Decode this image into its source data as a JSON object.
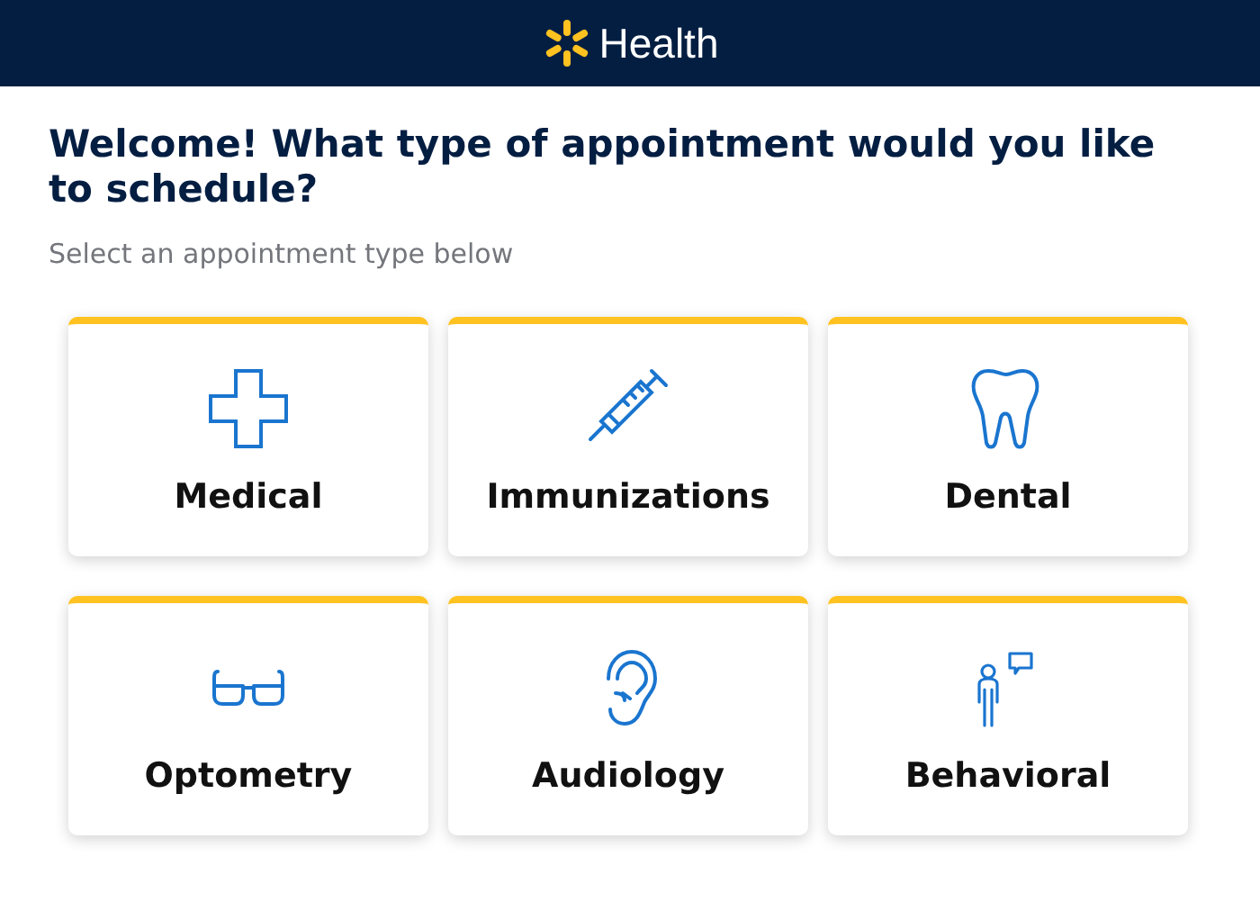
{
  "header": {
    "brand": "Health"
  },
  "title": "Welcome! What type of appointment would you like to schedule?",
  "subtitle": "Select an appointment type below",
  "cards": [
    {
      "kind": "medical",
      "label": "Medical"
    },
    {
      "kind": "immunizations",
      "label": "Immunizations"
    },
    {
      "kind": "dental",
      "label": "Dental"
    },
    {
      "kind": "optometry",
      "label": "Optometry"
    },
    {
      "kind": "audiology",
      "label": "Audiology"
    },
    {
      "kind": "behavioral",
      "label": "Behavioral"
    }
  ]
}
